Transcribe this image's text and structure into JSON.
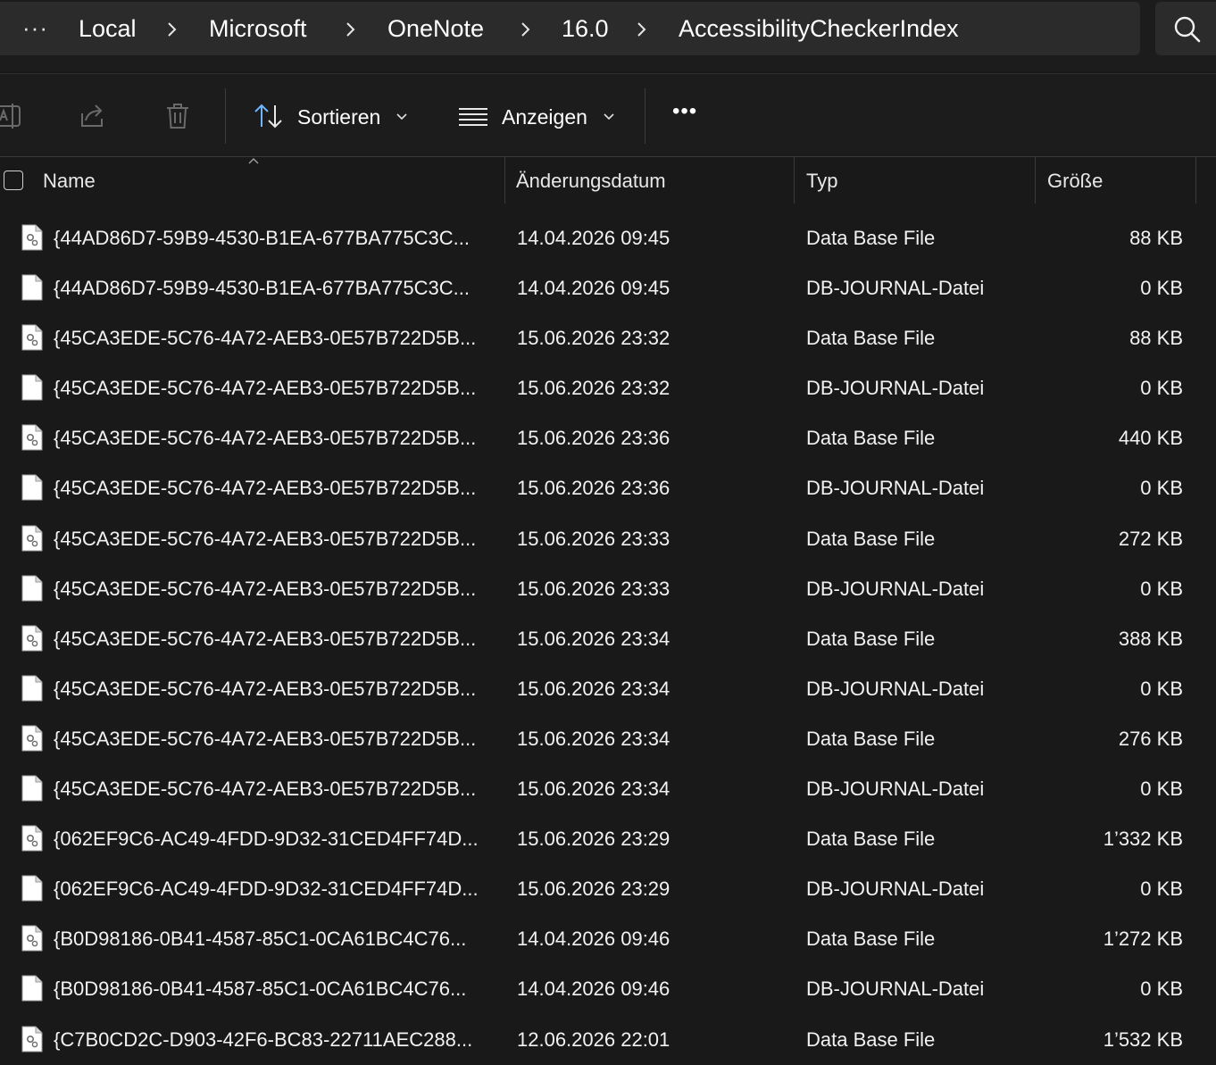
{
  "breadcrumb": {
    "overflow": "···",
    "items": [
      "Local",
      "Microsoft",
      "OneNote",
      "16.0",
      "AccessibilityCheckerIndex"
    ]
  },
  "toolbar": {
    "sort_label": "Sortieren",
    "view_label": "Anzeigen",
    "more_label": "•••"
  },
  "columns": {
    "name": "Name",
    "date": "Änderungsdatum",
    "type": "Typ",
    "size": "Größe"
  },
  "files": [
    {
      "icon": "database-file-icon",
      "name": "{44AD86D7-59B9-4530-B1EA-677BA775C3C...",
      "date": "14.04.2026 09:45",
      "type": "Data Base File",
      "size": "88 KB"
    },
    {
      "icon": "blank-file-icon",
      "name": "{44AD86D7-59B9-4530-B1EA-677BA775C3C...",
      "date": "14.04.2026 09:45",
      "type": "DB-JOURNAL-Datei",
      "size": "0 KB"
    },
    {
      "icon": "database-file-icon",
      "name": "{45CA3EDE-5C76-4A72-AEB3-0E57B722D5B...",
      "date": "15.06.2026 23:32",
      "type": "Data Base File",
      "size": "88 KB"
    },
    {
      "icon": "blank-file-icon",
      "name": "{45CA3EDE-5C76-4A72-AEB3-0E57B722D5B...",
      "date": "15.06.2026 23:32",
      "type": "DB-JOURNAL-Datei",
      "size": "0 KB"
    },
    {
      "icon": "database-file-icon",
      "name": "{45CA3EDE-5C76-4A72-AEB3-0E57B722D5B...",
      "date": "15.06.2026 23:36",
      "type": "Data Base File",
      "size": "440 KB"
    },
    {
      "icon": "blank-file-icon",
      "name": "{45CA3EDE-5C76-4A72-AEB3-0E57B722D5B...",
      "date": "15.06.2026 23:36",
      "type": "DB-JOURNAL-Datei",
      "size": "0 KB"
    },
    {
      "icon": "database-file-icon",
      "name": "{45CA3EDE-5C76-4A72-AEB3-0E57B722D5B...",
      "date": "15.06.2026 23:33",
      "type": "Data Base File",
      "size": "272 KB"
    },
    {
      "icon": "blank-file-icon",
      "name": "{45CA3EDE-5C76-4A72-AEB3-0E57B722D5B...",
      "date": "15.06.2026 23:33",
      "type": "DB-JOURNAL-Datei",
      "size": "0 KB"
    },
    {
      "icon": "database-file-icon",
      "name": "{45CA3EDE-5C76-4A72-AEB3-0E57B722D5B...",
      "date": "15.06.2026 23:34",
      "type": "Data Base File",
      "size": "388 KB"
    },
    {
      "icon": "blank-file-icon",
      "name": "{45CA3EDE-5C76-4A72-AEB3-0E57B722D5B...",
      "date": "15.06.2026 23:34",
      "type": "DB-JOURNAL-Datei",
      "size": "0 KB"
    },
    {
      "icon": "database-file-icon",
      "name": "{45CA3EDE-5C76-4A72-AEB3-0E57B722D5B...",
      "date": "15.06.2026 23:34",
      "type": "Data Base File",
      "size": "276 KB"
    },
    {
      "icon": "blank-file-icon",
      "name": "{45CA3EDE-5C76-4A72-AEB3-0E57B722D5B...",
      "date": "15.06.2026 23:34",
      "type": "DB-JOURNAL-Datei",
      "size": "0 KB"
    },
    {
      "icon": "database-file-icon",
      "name": "{062EF9C6-AC49-4FDD-9D32-31CED4FF74D...",
      "date": "15.06.2026 23:29",
      "type": "Data Base File",
      "size": "1’332 KB"
    },
    {
      "icon": "blank-file-icon",
      "name": "{062EF9C6-AC49-4FDD-9D32-31CED4FF74D...",
      "date": "15.06.2026 23:29",
      "type": "DB-JOURNAL-Datei",
      "size": "0 KB"
    },
    {
      "icon": "database-file-icon",
      "name": "{B0D98186-0B41-4587-85C1-0CA61BC4C76...",
      "date": "14.04.2026 09:46",
      "type": "Data Base File",
      "size": "1’272 KB"
    },
    {
      "icon": "blank-file-icon",
      "name": "{B0D98186-0B41-4587-85C1-0CA61BC4C76...",
      "date": "14.04.2026 09:46",
      "type": "DB-JOURNAL-Datei",
      "size": "0 KB"
    },
    {
      "icon": "database-file-icon",
      "name": "{C7B0CD2C-D903-42F6-BC83-22711AEC288...",
      "date": "12.06.2026 22:01",
      "type": "Data Base File",
      "size": "1’532 KB"
    }
  ]
}
